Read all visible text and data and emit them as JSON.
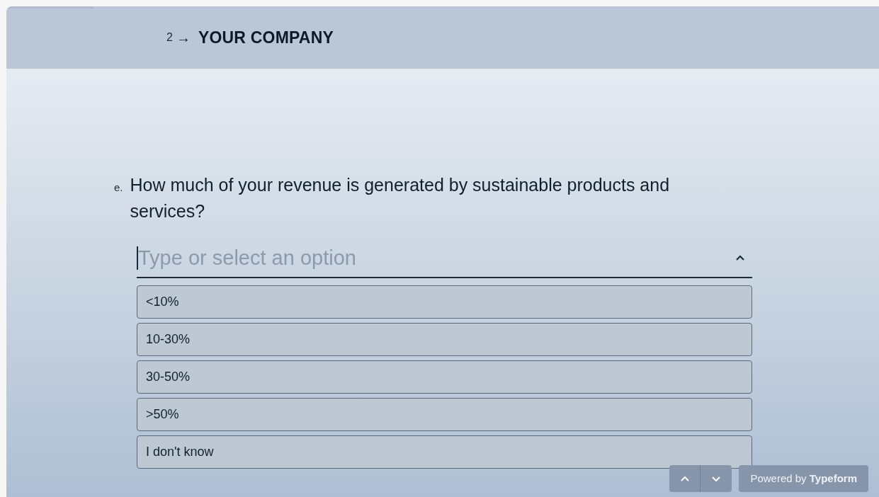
{
  "progress": {
    "level": 0.1
  },
  "section": {
    "number": "2",
    "arrow": "→",
    "title": "YOUR COMPANY"
  },
  "question": {
    "letter": "e.",
    "text": "How much of your revenue is generated by sustainable products and services?"
  },
  "dropdown": {
    "placeholder": "Type or select an option",
    "expanded": true,
    "options": [
      {
        "label": "<10%",
        "selected": false
      },
      {
        "label": "10-30%",
        "selected": false
      },
      {
        "label": "30-50%",
        "selected": false
      },
      {
        "label": ">50%",
        "selected": false
      },
      {
        "label": "I don't know",
        "selected": false
      }
    ]
  },
  "footer": {
    "branding": "Powered by **Typeform**"
  }
}
